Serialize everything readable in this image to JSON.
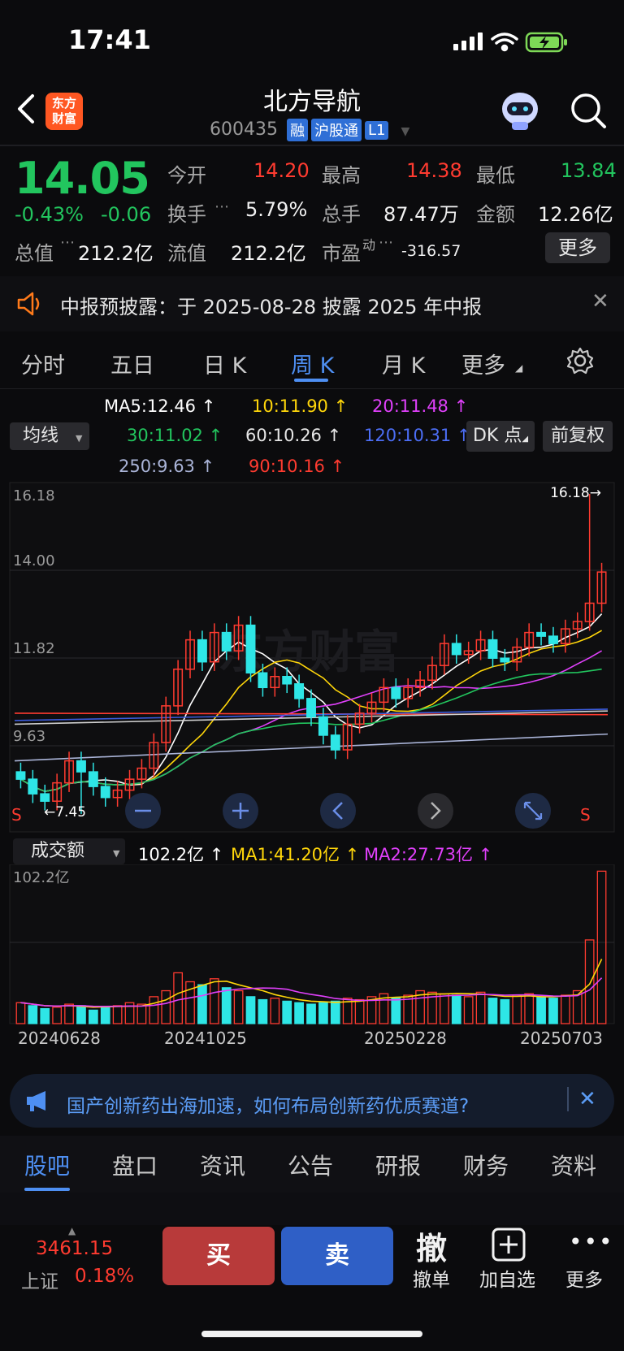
{
  "status_bar": {
    "time": "17:41"
  },
  "header": {
    "logo_text": "东方\n财富",
    "title": "北方导航",
    "code": "600435",
    "tags": [
      "融",
      "沪股通",
      "L1"
    ]
  },
  "quote": {
    "price": "14.05",
    "change_pct": "-0.43%",
    "change_abs": "-0.06",
    "open_label": "今开",
    "open_value": "14.20",
    "high_label": "最高",
    "high_value": "14.38",
    "low_label": "最低",
    "low_value": "13.84",
    "turnover_label": "换手",
    "turnover_value": "5.79%",
    "volume_label": "总手",
    "volume_value": "87.47万",
    "amount_label": "金额",
    "amount_value": "12.26亿",
    "mktcap_label": "总值",
    "mktcap_value": "212.2亿",
    "float_label": "流值",
    "float_value": "212.2亿",
    "pe_label": "市盈",
    "pe_sup": "动",
    "pe_value": "-316.57",
    "more_label": "更多"
  },
  "notice": {
    "text": "中报预披露：于 2025-08-28 披露 2025 年中报"
  },
  "chart_tabs": {
    "items": [
      "分时",
      "五日",
      "日 K",
      "周 K",
      "月 K",
      "更多"
    ],
    "active": "周 K"
  },
  "ma": {
    "dropdown": "均线",
    "ma5": "MA5:12.46 ↑",
    "ma10": "10:11.90 ↑",
    "ma20": "20:11.48 ↑",
    "ma30": "30:11.02 ↑",
    "ma60": "60:10.26 ↑",
    "ma120": "120:10.31 ↑",
    "ma250": "250:9.63 ↑",
    "ma90": "90:10.16 ↑",
    "dk_button": "DK 点",
    "adjust_button": "前复权",
    "colors": {
      "ma5": "#ffffff",
      "ma10": "#ffd60a",
      "ma20": "#e040fb",
      "ma30": "#22c55e",
      "ma60": "#d0d0d0",
      "ma120": "#3b5bdb",
      "ma250": "#aab4d8",
      "ma90": "#ff3b30"
    }
  },
  "kline": {
    "y_labels": [
      "16.18",
      "14.00",
      "11.82",
      "9.63",
      "7.45"
    ],
    "max_marker": "16.18→",
    "min_marker": "←7.45",
    "s_marker_left": "S",
    "s_marker_right": "S"
  },
  "volume": {
    "dropdown": "成交额",
    "amount": "102.2亿 ↑",
    "ma1": "MA1:41.20亿 ↑",
    "ma2": "MA2:27.73亿 ↑",
    "max_label": "102.2亿",
    "dates": [
      "20240628",
      "20241025",
      "20250228",
      "20250703"
    ]
  },
  "news_banner": {
    "text": "国产创新药出海加速，如何布局创新药优质赛道?"
  },
  "bottom_tabs": {
    "items": [
      "股吧",
      "盘口",
      "资讯",
      "公告",
      "研报",
      "财务",
      "资料"
    ],
    "active": "股吧"
  },
  "bottom_bar": {
    "index_value": "3461.15",
    "index_name": "上证",
    "index_change": "0.18%",
    "buy": "买",
    "sell": "卖",
    "cancel_icon_char": "撤",
    "cancel_label": "撤单",
    "watchlist_label": "加自选",
    "more_label": "更多"
  }
}
